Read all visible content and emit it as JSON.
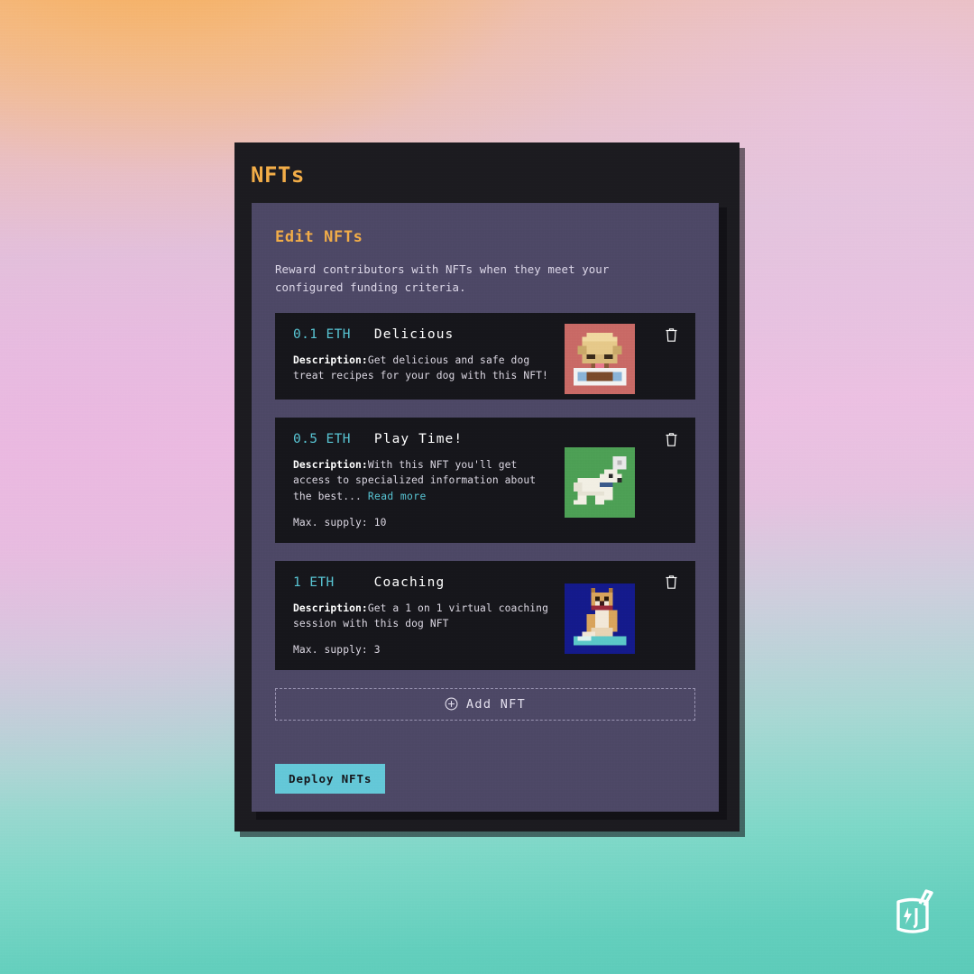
{
  "window": {
    "title": "NFTs"
  },
  "panel": {
    "title": "Edit NFTs",
    "description": "Reward contributors with NFTs when they meet your configured funding criteria."
  },
  "nfts": [
    {
      "price": "0.1 ETH",
      "name": "Delicious",
      "desc_label": "Description:",
      "desc_text": "Get delicious and safe dog treat recipes for your dog with this NFT!",
      "read_more": "",
      "supply": "",
      "thumb_name": "nft-thumbnail-delicious",
      "thumb_bg": "#c96a66",
      "delete_icon": "trash-icon"
    },
    {
      "price": "0.5 ETH",
      "name": "Play Time!",
      "desc_label": "Description:",
      "desc_text": "With this NFT you'll get access to specialized information about the best...",
      "read_more": "Read more",
      "supply": "Max. supply: 10",
      "thumb_name": "nft-thumbnail-play-time",
      "thumb_bg": "#4da055",
      "delete_icon": "trash-icon"
    },
    {
      "price": "1 ETH",
      "name": "Coaching",
      "desc_label": "Description:",
      "desc_text": "Get a 1 on 1 virtual coaching session with this dog NFT",
      "read_more": "",
      "supply": "Max. supply: 3",
      "thumb_name": "nft-thumbnail-coaching",
      "thumb_bg": "#141a8c",
      "delete_icon": "trash-icon"
    }
  ],
  "actions": {
    "add_nft_label": "Add NFT",
    "add_nft_icon": "plus-circle-icon",
    "deploy_label": "Deploy NFTs"
  },
  "watermark": {
    "icon": "juicebox-logo"
  },
  "colors": {
    "accent_gold": "#f2ad48",
    "accent_teal": "#58c5d4",
    "panel_bg": "#4d4866",
    "card_bg": "#16161b",
    "window_bg": "#1c1b20"
  }
}
